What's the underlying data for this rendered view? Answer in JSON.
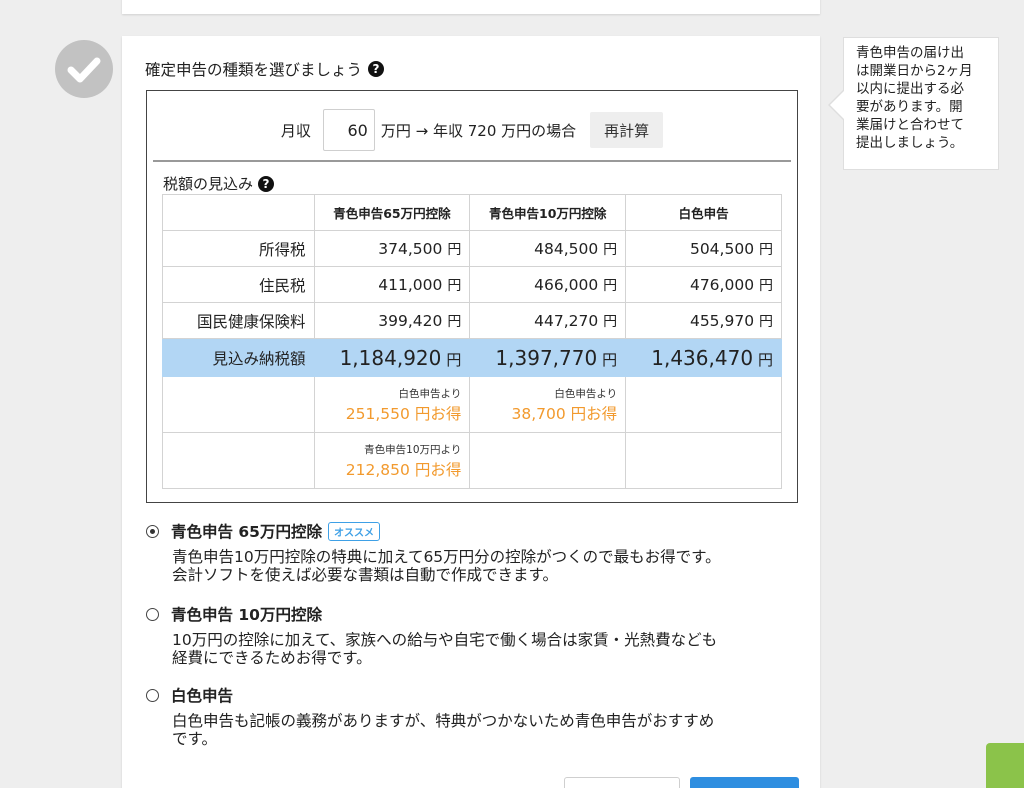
{
  "section": {
    "title": "確定申告の種類を選びましょう"
  },
  "income": {
    "label": "月収",
    "monthly_value": "60",
    "conversion_text": "万円 → 年収 720 万円の場合",
    "recalc_label": "再計算"
  },
  "tax_table": {
    "heading": "税額の見込み",
    "columns": [
      "青色申告65万円控除",
      "青色申告10万円控除",
      "白色申告"
    ],
    "unit": "円",
    "rows": [
      {
        "label": "所得税",
        "values": [
          "374,500",
          "484,500",
          "504,500"
        ]
      },
      {
        "label": "住民税",
        "values": [
          "411,000",
          "466,000",
          "476,000"
        ]
      },
      {
        "label": "国民健康保険料",
        "values": [
          "399,420",
          "447,270",
          "455,970"
        ]
      }
    ],
    "total": {
      "label": "見込み納税額",
      "values": [
        "1,184,920",
        "1,397,770",
        "1,436,470"
      ]
    },
    "savings_1": [
      {
        "note": "白色申告より",
        "amount": "251,550 円お得"
      },
      {
        "note": "白色申告より",
        "amount": "38,700 円お得"
      }
    ],
    "savings_2": [
      {
        "note": "青色申告10万円より",
        "amount": "212,850 円お得"
      }
    ]
  },
  "options": [
    {
      "title": "青色申告 65万円控除",
      "badge": "オススメ",
      "selected": true,
      "desc_line1": "青色申告10万円控除の特典に加えて65万円分の控除がつくので最もお得です。",
      "desc_line2": "会計ソフトを使えば必要な書類は自動で作成できます。"
    },
    {
      "title": "青色申告 10万円控除",
      "selected": false,
      "desc_line1": "10万円の控除に加えて、家族への給与や自宅で働く場合は家賃・光熱費なども",
      "desc_line2": "経費にできるためお得です。"
    },
    {
      "title": "白色申告",
      "selected": false,
      "desc_line1": "白色申告も記帳の義務がありますが、特典がつかないため青色申告がおすすめ",
      "desc_line2": "です。"
    }
  ],
  "tip": {
    "lines": [
      "青色申告の届け出",
      "は開業日から2ヶ月",
      "以内に提出する必",
      "要があります。開",
      "業届けと合わせて",
      "提出しましょう。"
    ]
  },
  "colors": {
    "accent_blue": "#2e8ee0",
    "highlight_row": "#b2d6f4",
    "savings_orange": "#f29a2e",
    "help_green": "#8bc34a"
  }
}
